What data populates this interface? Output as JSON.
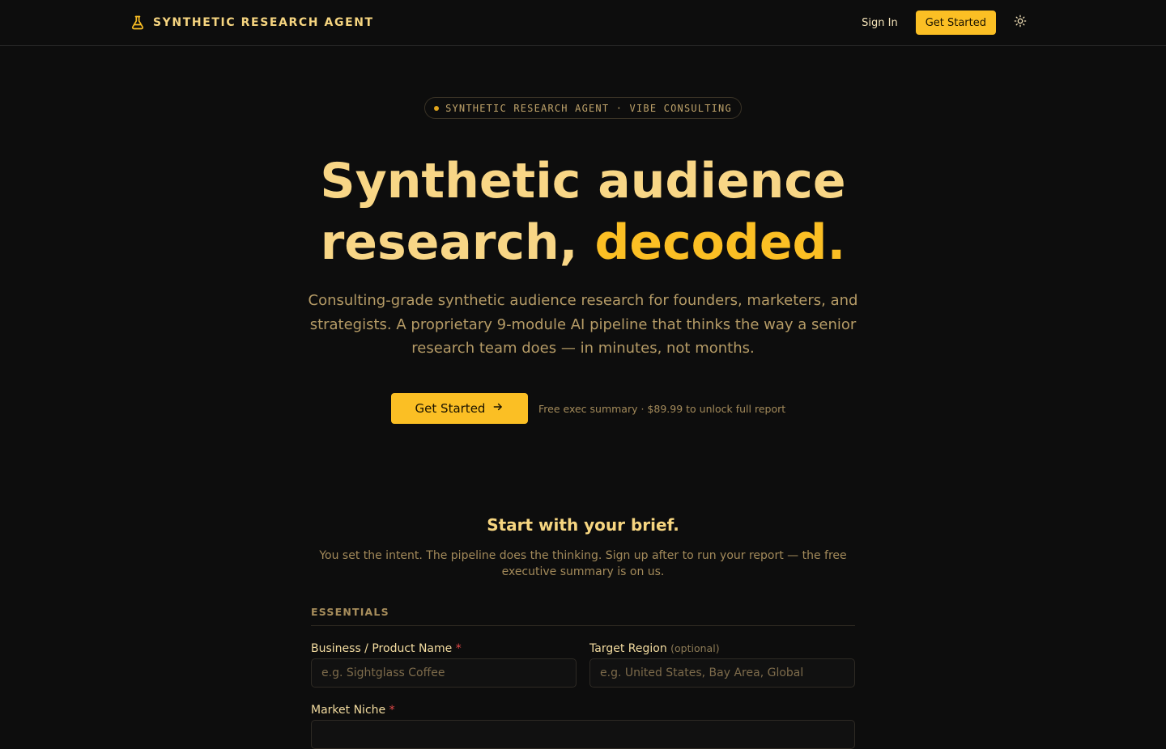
{
  "nav": {
    "brand": "SYNTHETIC RESEARCH AGENT",
    "brand_icon": "flask-icon",
    "sign_in": "Sign In",
    "get_started": "Get Started",
    "theme_icon": "sun-icon"
  },
  "hero": {
    "pill": "SYNTHETIC RESEARCH AGENT · VIBE CONSULTING",
    "title_line1": "Synthetic audience",
    "title_line2_a": "research, ",
    "title_line2_b": "decoded.",
    "subtitle": "Consulting-grade synthetic audience research for founders, marketers, and strategists. A proprietary 9-module AI pipeline that thinks the way a senior research team does — in minutes, not months.",
    "cta_label": "Get Started",
    "cta_icon": "arrow-right-icon",
    "cta_note": "Free exec summary · $89.99 to unlock full report"
  },
  "brief": {
    "title": "Start with your brief.",
    "subtitle": "You set the intent. The pipeline does the thinking. Sign up after to run your report — the free executive summary is on us.",
    "section": "ESSENTIALS",
    "fields": {
      "business": {
        "label": "Business / Product Name",
        "required_mark": "*",
        "placeholder": "e.g. Sightglass Coffee",
        "value": ""
      },
      "region": {
        "label": "Target Region",
        "optional_note": "(optional)",
        "placeholder": "e.g. United States, Bay Area, Global",
        "value": ""
      },
      "niche": {
        "label": "Market Niche",
        "required_mark": "*",
        "value": ""
      }
    }
  },
  "colors": {
    "background": "#0d0d0d",
    "accent": "#fbbf24",
    "title": "#f8d686",
    "muted": "#b59b66",
    "required": "#e04848"
  }
}
